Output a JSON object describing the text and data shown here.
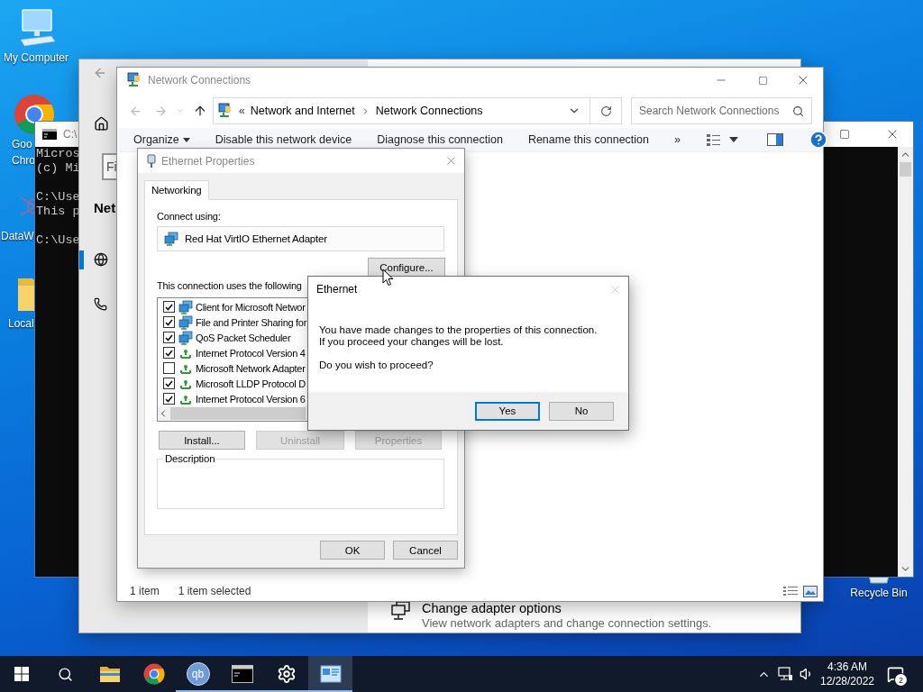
{
  "desktop_icons": [
    {
      "kind": "computer",
      "lines": [
        "My Computer"
      ]
    },
    {
      "kind": "chrome",
      "lines": [
        "Goo",
        "Chro"
      ]
    },
    {
      "kind": "app",
      "lines": [
        "DataW"
      ]
    },
    {
      "kind": "folder",
      "lines": [
        "Local"
      ]
    },
    {
      "kind": "recycle",
      "lines": [
        "Recycle Bin"
      ]
    }
  ],
  "console_window": {
    "title": "C:\\",
    "blocks": [
      [
        "Micros",
        "(c) Mi"
      ],
      [
        "C:\\Use",
        "This p"
      ],
      [
        "C:\\Use"
      ]
    ]
  },
  "settings_window": {
    "search": {
      "placeholder": "Fi"
    },
    "heading": "Net",
    "nav": [
      {
        "kind": "globe",
        "selected": true
      },
      {
        "kind": "dialup",
        "selected": false
      }
    ],
    "link": {
      "title": "Change adapter options",
      "description": "View network adapters and change connection settings."
    }
  },
  "explorer_window": {
    "title": "Network Connections",
    "address_overflow": "«",
    "breadcrumb": [
      "Network and Internet",
      "Network Connections"
    ],
    "search": {
      "placeholder": "Search Network Connections"
    },
    "toolbar": [
      {
        "kind": "menu",
        "label": "Organize"
      },
      {
        "kind": "command",
        "label": "Disable this network device"
      },
      {
        "kind": "command",
        "label": "Diagnose this connection"
      },
      {
        "kind": "command",
        "label": "Rename this connection"
      },
      {
        "kind": "more",
        "label": "»"
      }
    ],
    "status": [
      "1 item",
      "1 item selected"
    ]
  },
  "properties_dialog": {
    "title": "Ethernet Properties",
    "tabs": [
      {
        "label": "Networking",
        "selected": true
      }
    ],
    "connect_label": "Connect using:",
    "adapter": "Red Hat VirtIO Ethernet Adapter",
    "configure_button": "Configure...",
    "components_label": "This connection uses the following",
    "components": [
      {
        "kind": "client",
        "label": "Client for Microsoft Networ",
        "checked": true
      },
      {
        "kind": "client",
        "label": "File and Printer Sharing for",
        "checked": true
      },
      {
        "kind": "client",
        "label": "QoS Packet Scheduler",
        "checked": true
      },
      {
        "kind": "protocol",
        "label": "Internet Protocol Version 4",
        "checked": true
      },
      {
        "kind": "protocol",
        "label": "Microsoft Network Adapter",
        "checked": false
      },
      {
        "kind": "protocol",
        "label": "Microsoft LLDP Protocol D",
        "checked": true
      },
      {
        "kind": "protocol",
        "label": "Internet Protocol Version 6",
        "checked": true
      }
    ],
    "buttons": [
      {
        "label": "Install...",
        "disabled": false
      },
      {
        "label": "Uninstall",
        "disabled": true
      },
      {
        "label": "Properties",
        "disabled": true
      }
    ],
    "description_label": "Description",
    "footer_buttons": [
      "OK",
      "Cancel"
    ]
  },
  "message_box": {
    "title": "Ethernet",
    "message": "You have made changes to the properties of this connection.\nIf you proceed your changes will be lost.",
    "question": "Do you wish to proceed?",
    "buttons": [
      {
        "label": "Yes",
        "default": true
      },
      {
        "label": "No",
        "default": false
      }
    ]
  },
  "taskbar": {
    "apps": [
      {
        "kind": "explorer",
        "running": false,
        "selected": false
      },
      {
        "kind": "chrome",
        "running": false,
        "selected": false
      },
      {
        "kind": "qbittorrent",
        "glyph": "qb",
        "running": true,
        "selected": false
      },
      {
        "kind": "console",
        "running": true,
        "selected": false
      },
      {
        "kind": "settings",
        "running": true,
        "selected": false
      },
      {
        "kind": "network",
        "running": true,
        "selected": true
      }
    ],
    "time": "4:36 AM",
    "date": "12/28/2022",
    "notification_count": "2"
  }
}
